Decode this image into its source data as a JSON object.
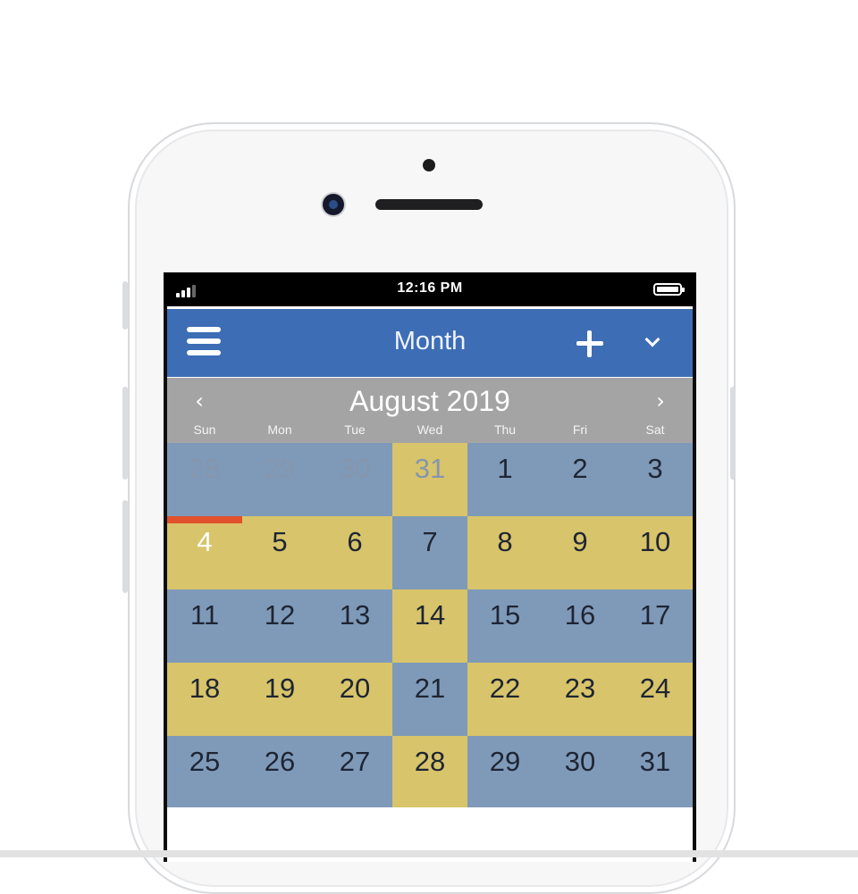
{
  "status_bar": {
    "time": "12:16 PM"
  },
  "nav": {
    "title": "Month",
    "menu_icon": "hamburger-menu-icon",
    "add_icon": "plus-icon",
    "dropdown_icon": "chevron-down-icon"
  },
  "calendar": {
    "month_title": "August 2019",
    "prev_icon": "chevron-left-icon",
    "next_icon": "chevron-right-icon",
    "prev_glyph": "‹",
    "next_glyph": "›",
    "weekdays": [
      "Sun",
      "Mon",
      "Tue",
      "Wed",
      "Thu",
      "Fri",
      "Sat"
    ],
    "today": "4",
    "colors": {
      "blue": "#7f9ab9",
      "yellow": "#d8c46a",
      "today_marker": "#e2512c",
      "nav": "#3d6db5",
      "header": "#a4a4a4"
    },
    "weeks": [
      [
        {
          "day": "28",
          "color": "blue",
          "muted": true
        },
        {
          "day": "29",
          "color": "blue",
          "muted": true
        },
        {
          "day": "30",
          "color": "blue",
          "muted": true
        },
        {
          "day": "31",
          "color": "yellow",
          "muted": true
        },
        {
          "day": "1",
          "color": "blue"
        },
        {
          "day": "2",
          "color": "blue"
        },
        {
          "day": "3",
          "color": "blue"
        }
      ],
      [
        {
          "day": "4",
          "color": "yellow",
          "today": true
        },
        {
          "day": "5",
          "color": "yellow"
        },
        {
          "day": "6",
          "color": "yellow"
        },
        {
          "day": "7",
          "color": "blue"
        },
        {
          "day": "8",
          "color": "yellow"
        },
        {
          "day": "9",
          "color": "yellow"
        },
        {
          "day": "10",
          "color": "yellow"
        }
      ],
      [
        {
          "day": "11",
          "color": "blue"
        },
        {
          "day": "12",
          "color": "blue"
        },
        {
          "day": "13",
          "color": "blue"
        },
        {
          "day": "14",
          "color": "yellow"
        },
        {
          "day": "15",
          "color": "blue"
        },
        {
          "day": "16",
          "color": "blue"
        },
        {
          "day": "17",
          "color": "blue"
        }
      ],
      [
        {
          "day": "18",
          "color": "yellow"
        },
        {
          "day": "19",
          "color": "yellow"
        },
        {
          "day": "20",
          "color": "yellow"
        },
        {
          "day": "21",
          "color": "blue"
        },
        {
          "day": "22",
          "color": "yellow"
        },
        {
          "day": "23",
          "color": "yellow"
        },
        {
          "day": "24",
          "color": "yellow"
        }
      ],
      [
        {
          "day": "25",
          "color": "blue"
        },
        {
          "day": "26",
          "color": "blue"
        },
        {
          "day": "27",
          "color": "blue"
        },
        {
          "day": "28",
          "color": "yellow"
        },
        {
          "day": "29",
          "color": "blue"
        },
        {
          "day": "30",
          "color": "blue"
        },
        {
          "day": "31",
          "color": "blue"
        }
      ]
    ]
  }
}
